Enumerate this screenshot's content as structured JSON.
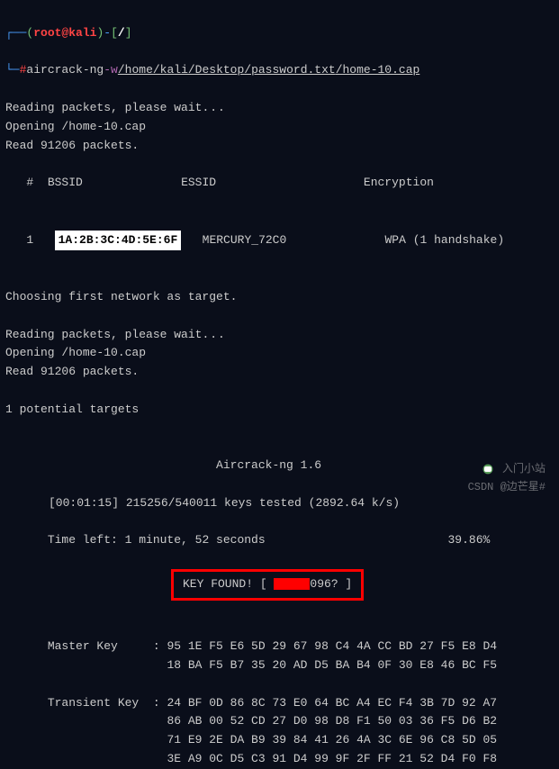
{
  "prompt": {
    "user_host": "root@kali",
    "cwd": "/",
    "symbol": "#"
  },
  "command": {
    "name": "aircrack-ng",
    "flag": "-w",
    "wordlist": "/home/kali/Desktop/password.txt",
    "capfile": "/home-10.cap"
  },
  "output": {
    "reading1": "Reading packets, please wait",
    "dots": "...",
    "opening1": "Opening /home-10.cap",
    "read1": "Read 91206 packets.",
    "header_num": "#",
    "header_bssid": "BSSID",
    "header_essid": "ESSID",
    "header_enc": "Encryption",
    "row_num": "1",
    "row_bssid": "1A:2B:3C:4D:5E:6F",
    "row_essid": "MERCURY_72C0",
    "row_enc": "WPA (1 handshake)",
    "choosing": "Choosing first network as target.",
    "reading2": "Reading packets, please wait",
    "opening2": "Opening /home-10.cap",
    "read2": "Read 91206 packets.",
    "potential": "1 potential targets",
    "version": "Aircrack-ng 1.6",
    "progress": "[00:01:15] 215256/540011 keys tested (2892.64 k/s)",
    "timeleft_label": "Time left: 1 minute, 52 seconds",
    "percent": "39.86%",
    "key_found_pre": "KEY FOUND! [ ",
    "key_found_post": "096? ]",
    "master_label": "Master Key     : ",
    "master1": "95 1E F5 E6 5D 29 67 98 C4 4A CC BD 27 F5 E8 D4",
    "master2": "18 BA F5 B7 35 20 AD D5 BA B4 0F 30 E8 46 BC F5",
    "trans_label": "Transient Key  : ",
    "trans1": "24 BF 0D 86 8C 73 E0 64 BC A4 EC F4 3B 7D 92 A7",
    "trans2": "86 AB 00 52 CD 27 D0 98 D8 F1 50 03 36 F5 D6 B2",
    "trans3": "71 E9 2E DA B9 39 84 41 26 4A 3C 6E 96 C8 5D 05",
    "trans4": "3E A9 0C D5 C3 91 D4 99 9F 2F FF 21 52 D4 F0 F8"
  },
  "watermark": {
    "line1": "入门小站",
    "line2": "CSDN @边芒星#"
  }
}
